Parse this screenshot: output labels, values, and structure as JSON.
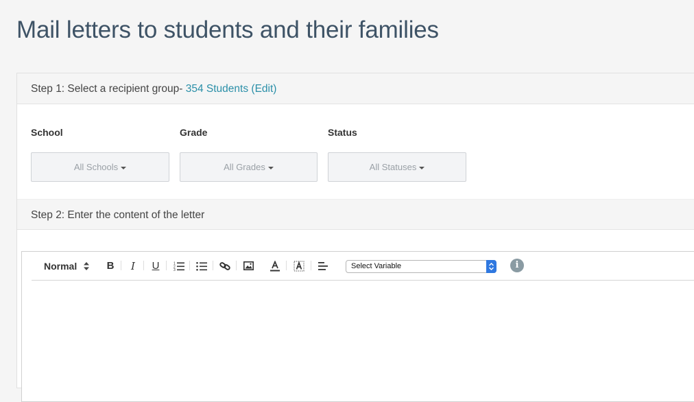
{
  "page": {
    "title": "Mail letters to students and their families"
  },
  "step1": {
    "prefix": "Step 1: Select a recipient group- ",
    "recipient_count": "354 Students",
    "edit_open": " (",
    "edit_label": "Edit",
    "edit_close": ")"
  },
  "filters": {
    "school": {
      "label": "School",
      "value": "All Schools"
    },
    "grade": {
      "label": "Grade",
      "value": "All Grades"
    },
    "status": {
      "label": "Status",
      "value": "All Statuses"
    }
  },
  "step2": {
    "label": "Step 2: Enter the content of the letter"
  },
  "toolbar": {
    "format_select": "Normal",
    "bold": "B",
    "italic": "I",
    "underline": "U",
    "variable_select": "Select Variable",
    "info": "i",
    "icons": [
      "bold-icon",
      "italic-icon",
      "underline-icon",
      "ordered-list-icon",
      "bullet-list-icon",
      "link-icon",
      "image-icon",
      "text-color-icon",
      "background-color-icon",
      "align-icon",
      "info-icon"
    ]
  },
  "colors": {
    "title": "#3e5366",
    "link": "#2a8fa8",
    "select_arrow": "#2f78e0",
    "info_icon": "#8a9ba3"
  }
}
